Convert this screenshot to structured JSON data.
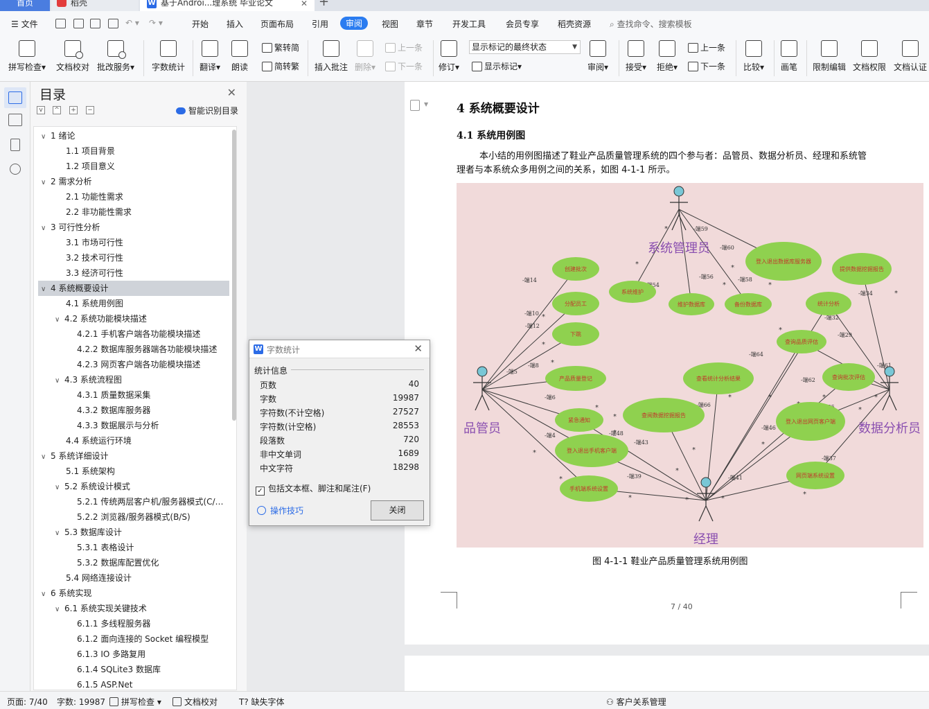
{
  "tabs": {
    "home": "首页",
    "daoke": "稻壳",
    "doc": "基于Androi...理系统 毕业论文"
  },
  "menu": {
    "file": "文件",
    "items": [
      "开始",
      "插入",
      "页面布局",
      "引用",
      "审阅",
      "视图",
      "章节",
      "开发工具",
      "会员专享",
      "稻壳资源"
    ],
    "active": "审阅",
    "search": "查找命令、搜索模板"
  },
  "ribbon": {
    "spell": "拼写检查",
    "doccheck": "文档校对",
    "batch": "批改服务",
    "wordcount": "字数统计",
    "translate": "翻译",
    "read": "朗读",
    "to_trad": "繁转简",
    "to_simp": "简转繁",
    "insert_comment": "插入批注",
    "delete": "删除",
    "prev": "上一条",
    "next": "下一条",
    "revise": "修订",
    "mark_state": "显示标记的最终状态",
    "show_mark": "显示标记",
    "review": "审阅",
    "accept": "接受",
    "reject": "拒绝",
    "prev2": "上一条",
    "next2": "下一条",
    "compare": "比较",
    "pen": "画笔",
    "restrict": "限制编辑",
    "perm": "文档权限",
    "auth": "文档认证"
  },
  "toc": {
    "title": "目录",
    "smart": "智能识别目录",
    "items": [
      {
        "label": "1  绪论",
        "level": 1,
        "caret": "v"
      },
      {
        "label": "1.1 项目背景",
        "level": 2,
        "caret": ""
      },
      {
        "label": "1.2 项目意义",
        "level": 2,
        "caret": ""
      },
      {
        "label": "2  需求分析",
        "level": 1,
        "caret": "v"
      },
      {
        "label": "2.1 功能性需求",
        "level": 2,
        "caret": ""
      },
      {
        "label": "2.2 非功能性需求",
        "level": 2,
        "caret": ""
      },
      {
        "label": "3  可行性分析",
        "level": 1,
        "caret": "v"
      },
      {
        "label": "3.1 市场可行性",
        "level": 2,
        "caret": ""
      },
      {
        "label": "3.2 技术可行性",
        "level": 2,
        "caret": ""
      },
      {
        "label": "3.3 经济可行性",
        "level": 2,
        "caret": ""
      },
      {
        "label": "4  系统概要设计",
        "level": 1,
        "caret": "v",
        "selected": true
      },
      {
        "label": "4.1 系统用例图",
        "level": 2,
        "caret": ""
      },
      {
        "label": "4.2 系统功能模块描述",
        "level": 2,
        "caret": "v"
      },
      {
        "label": "4.2.1 手机客户端各功能模块描述",
        "level": 3,
        "caret": ""
      },
      {
        "label": "4.2.2 数据库服务器端各功能模块描述",
        "level": 3,
        "caret": ""
      },
      {
        "label": "4.2.3 网页客户端各功能模块描述",
        "level": 3,
        "caret": ""
      },
      {
        "label": "4.3 系统流程图",
        "level": 2,
        "caret": "v"
      },
      {
        "label": "4.3.1 质量数据采集",
        "level": 3,
        "caret": ""
      },
      {
        "label": "4.3.2 数据库服务器",
        "level": 3,
        "caret": ""
      },
      {
        "label": "4.3.3 数据展示与分析",
        "level": 3,
        "caret": ""
      },
      {
        "label": "4.4  系统运行环境",
        "level": 2,
        "caret": ""
      },
      {
        "label": "5  系统详细设计",
        "level": 1,
        "caret": "v"
      },
      {
        "label": "5.1 系统架构",
        "level": 2,
        "caret": ""
      },
      {
        "label": "5.2 系统设计模式",
        "level": 2,
        "caret": "v"
      },
      {
        "label": "5.2.1 传统两层客户机/服务器模式(C/S...",
        "level": 3,
        "caret": ""
      },
      {
        "label": "5.2.2 浏览器/服务器模式(B/S)",
        "level": 3,
        "caret": ""
      },
      {
        "label": "5.3 数据库设计",
        "level": 2,
        "caret": "v"
      },
      {
        "label": "5.3.1 表格设计",
        "level": 3,
        "caret": ""
      },
      {
        "label": "5.3.2 数据库配置优化",
        "level": 3,
        "caret": ""
      },
      {
        "label": "5.4 网络连接设计",
        "level": 2,
        "caret": ""
      },
      {
        "label": "6  系统实现",
        "level": 1,
        "caret": "v"
      },
      {
        "label": "6.1  系统实现关键技术",
        "level": 2,
        "caret": "v"
      },
      {
        "label": "6.1.1 多线程服务器",
        "level": 3,
        "caret": ""
      },
      {
        "label": "6.1.2 面向连接的 Socket 编程模型",
        "level": 3,
        "caret": ""
      },
      {
        "label": "6.1.3 IO 多路复用",
        "level": 3,
        "caret": ""
      },
      {
        "label": "6.1.4 SQLite3 数据库",
        "level": 3,
        "caret": ""
      },
      {
        "label": "6.1.5 ASP.Net",
        "level": 3,
        "caret": ""
      }
    ]
  },
  "doc": {
    "h1": "4  系统概要设计",
    "h2": "4.1 系统用例图",
    "para1": "本小结的用例图描述了鞋业产品质量管理系统的四个参与者：品管员、数据分析员、经理和系统管",
    "para2": "理者与本系统众多用例之间的关系，如图 4-1-1 所示。",
    "caption": "图 4-1-1  鞋业产品质量管理系统用例图",
    "page_indicator": "7 / 40"
  },
  "diagram": {
    "actors": {
      "admin": "系统管理员",
      "qc": "品管员",
      "analyst": "数据分析员",
      "manager": "经理"
    },
    "usecases": {
      "create_batch": "创建批次",
      "assign_worker": "分配员工",
      "pick": "下跳",
      "register_quality": "产品质量登记",
      "emergency": "紧急通知",
      "mobile_login": "登入退出手机客户端",
      "mobile_settings": "手机端系统设置",
      "sys_maintain": "系统维护",
      "db_maintain": "维护数据库",
      "db_backup": "备份数据库",
      "db_server_login": "登入退出数据库服务器",
      "provide_report": "提供数据挖掘报告",
      "stats": "统计分析",
      "query_quality": "查询品质评估",
      "query_batch": "查询批次评估",
      "view_stats": "查看统计分析结果",
      "view_report": "查阅数据挖掘报告",
      "web_login": "登入退出网页客户端",
      "web_settings": "网页端系统设置"
    },
    "edge_labels": [
      "-端59",
      "-端60",
      "-端54",
      "-端56",
      "-端58",
      "-端14",
      "-端10",
      "-端12",
      "-端8",
      "-端5",
      "-端6",
      "-端4",
      "-端48",
      "-端43",
      "-端39",
      "-端49",
      "-端66",
      "-端64",
      "-端62",
      "-端34",
      "-端32",
      "-端29",
      "-端35",
      "-端46",
      "-端37",
      "-端61",
      "-端42",
      "-端41"
    ],
    "multiplicity": "*"
  },
  "dialog": {
    "title": "字数统计",
    "section": "统计信息",
    "rows": [
      {
        "label": "页数",
        "value": "40"
      },
      {
        "label": "字数",
        "value": "19987"
      },
      {
        "label": "字符数(不计空格)",
        "value": "27527"
      },
      {
        "label": "字符数(计空格)",
        "value": "28553"
      },
      {
        "label": "段落数",
        "value": "720"
      },
      {
        "label": "非中文单词",
        "value": "1689"
      },
      {
        "label": "中文字符",
        "value": "18298"
      }
    ],
    "include": "包括文本框、脚注和尾注(F)",
    "tips": "操作技巧",
    "close": "关闭"
  },
  "status": {
    "page": "页面: 7/40",
    "words": "字数: 19987",
    "spell": "拼写检查",
    "doccheck": "文档校对",
    "font": "缺失字体",
    "crm": "客户关系管理"
  },
  "colors": {
    "accent": "#2b7cf0",
    "figure_bg": "#f1dada",
    "usecase": "#8fd14f",
    "actor_head": "#79c7d6",
    "actor_label": "#8a4fb0",
    "usecase_text": "#c0392b"
  }
}
